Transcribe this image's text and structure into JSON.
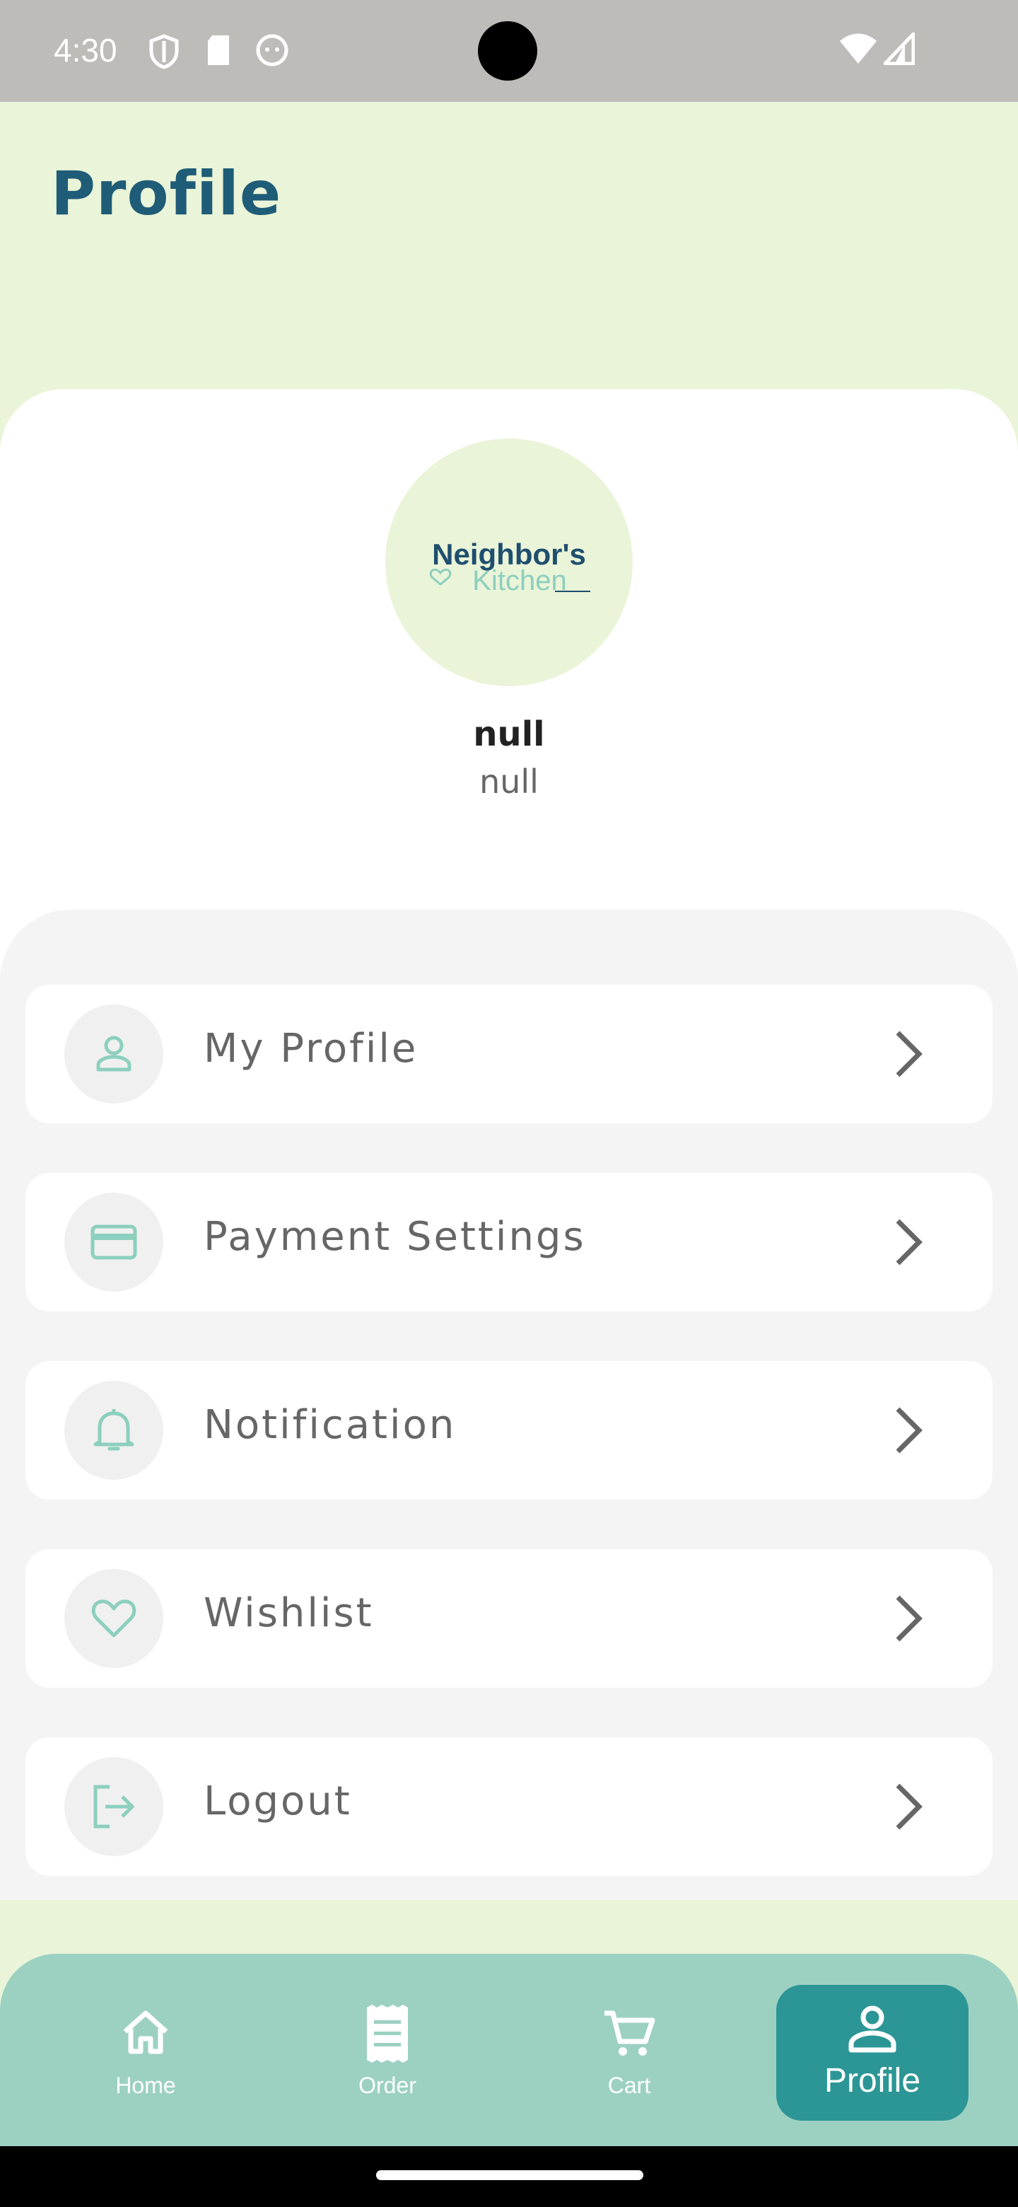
{
  "status_bar": {
    "time": "4:30"
  },
  "header": {
    "title": "Profile"
  },
  "profile": {
    "avatar_logo_text": "Neighbor's Kitchen",
    "name": "null",
    "email": "null"
  },
  "menu": [
    {
      "label": "My Profile",
      "icon": "person-icon"
    },
    {
      "label": "Payment Settings",
      "icon": "credit-card-icon"
    },
    {
      "label": "Notification",
      "icon": "bell-icon"
    },
    {
      "label": "Wishlist",
      "icon": "heart-icon"
    },
    {
      "label": "Logout",
      "icon": "logout-icon"
    }
  ],
  "bottom_nav": [
    {
      "label": "Home",
      "icon": "home-icon",
      "active": false
    },
    {
      "label": "Order",
      "icon": "receipt-icon",
      "active": false
    },
    {
      "label": "Cart",
      "icon": "cart-icon",
      "active": false
    },
    {
      "label": "Profile",
      "icon": "person-icon",
      "active": true
    }
  ],
  "colors": {
    "header_bg": "#EAF4D8",
    "title": "#1F5C77",
    "accent_icon": "#8CCFBE",
    "nav_bg": "#9CD1C2",
    "nav_active": "#2C9696"
  }
}
